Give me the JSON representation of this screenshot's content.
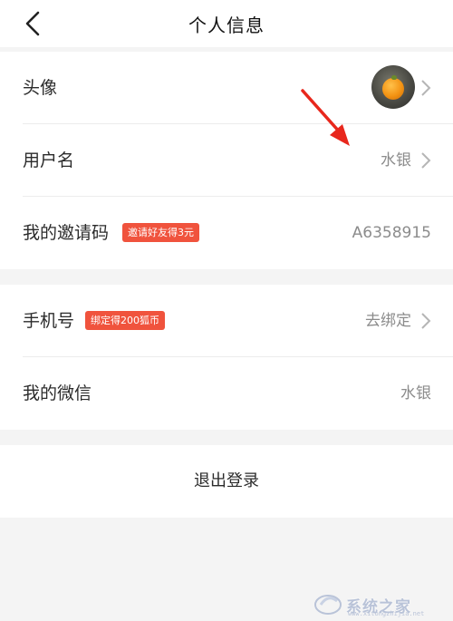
{
  "header": {
    "title": "个人信息",
    "back_icon": "chevron-left-icon"
  },
  "profile": {
    "avatar": {
      "label": "头像"
    },
    "username": {
      "label": "用户名",
      "value": "水银"
    },
    "invite_code": {
      "label": "我的邀请码",
      "badge": "邀请好友得3元",
      "value": "A6358915"
    }
  },
  "account": {
    "phone": {
      "label": "手机号",
      "badge": "绑定得200狐币",
      "value": "去绑定"
    },
    "wechat": {
      "label": "我的微信",
      "value": "水银"
    }
  },
  "logout": {
    "label": "退出登录"
  },
  "watermark": {
    "text": "系统之家",
    "sub": "www.xitongzhijia.net"
  },
  "colors": {
    "badge": "#f0533d",
    "arrow": "#e8271c",
    "secondary_text": "#8c8c8c",
    "background": "#f4f4f4"
  }
}
